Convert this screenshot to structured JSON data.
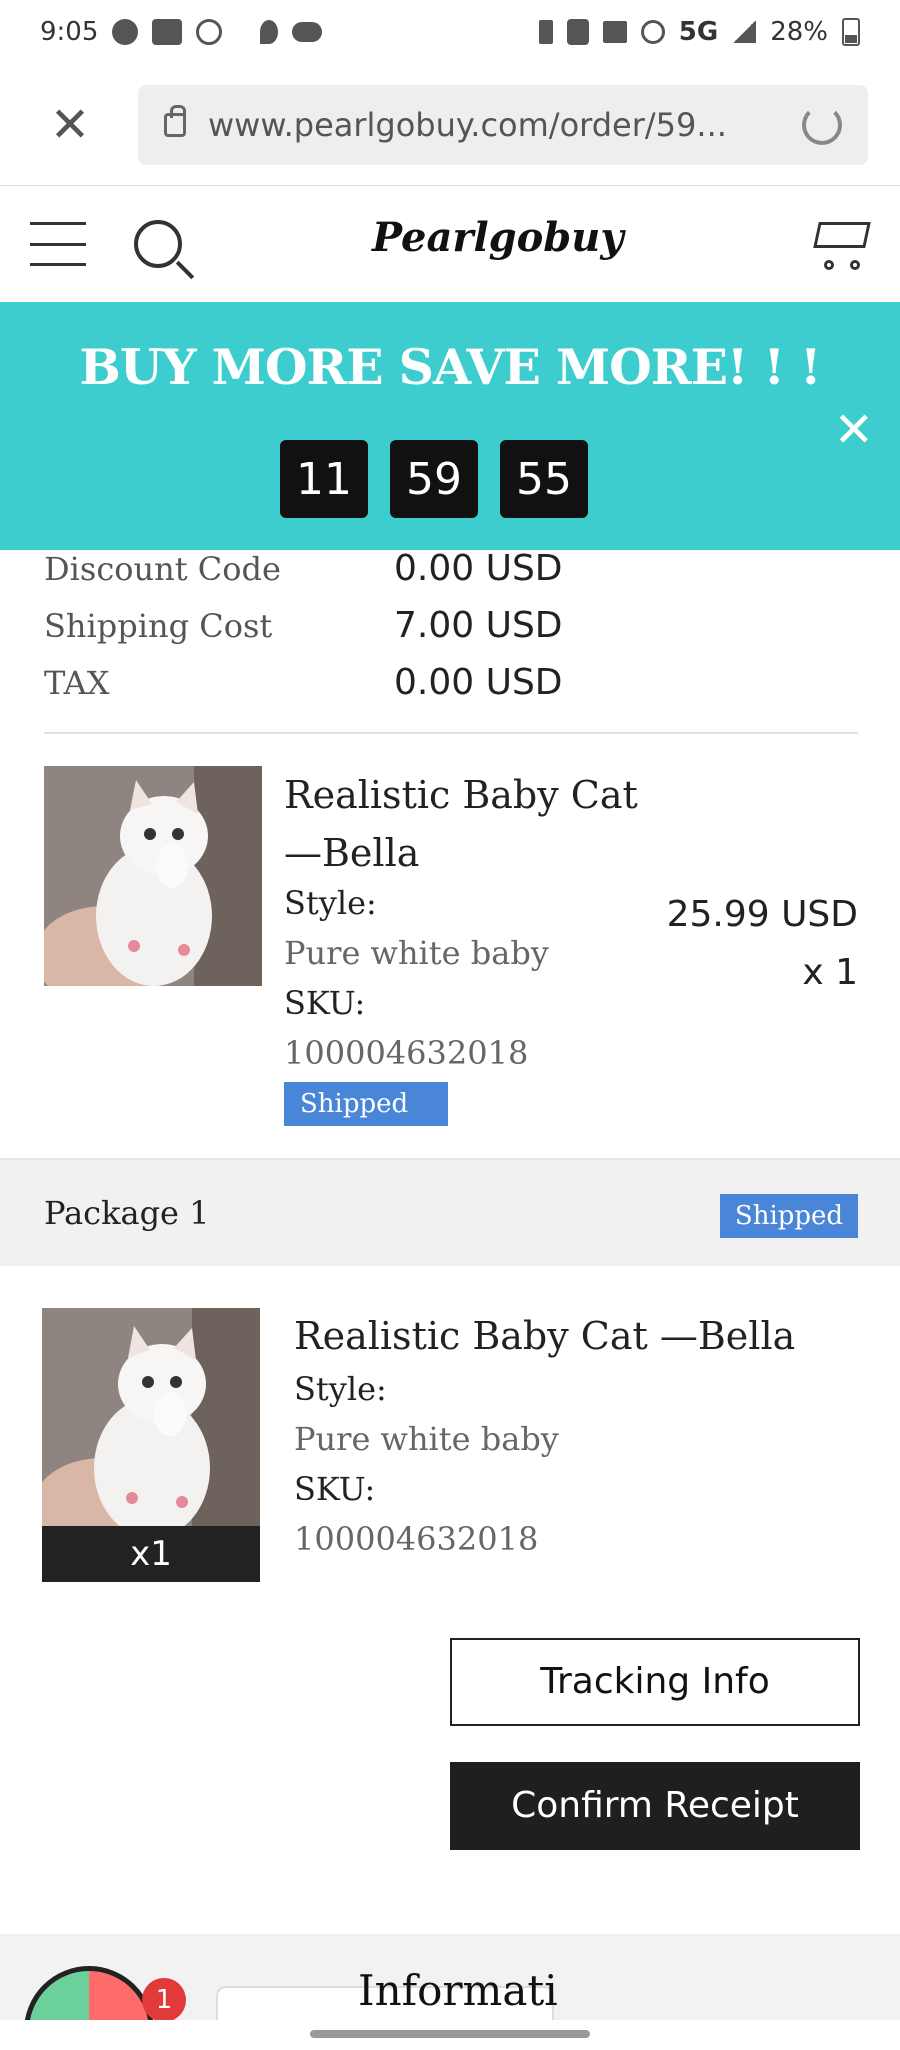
{
  "status_bar": {
    "time": "9:05",
    "network": "5G",
    "battery": "28%"
  },
  "browser": {
    "url": "www.pearlgobuy.com/order/59..."
  },
  "header": {
    "logo": "Pearlgobuy"
  },
  "promo": {
    "title": "BUY MORE SAVE MORE! ! !",
    "timer": [
      "11",
      "59",
      "55"
    ]
  },
  "summary": [
    {
      "label": "Discount Code",
      "value": "0.00 USD"
    },
    {
      "label": "Shipping Cost",
      "value": "7.00 USD"
    },
    {
      "label": "TAX",
      "value": "0.00 USD"
    }
  ],
  "order_item": {
    "name": "Realistic Baby Cat —Bella",
    "style_label": "Style:",
    "style": "Pure white baby",
    "sku_label": "SKU:",
    "sku": "100004632018",
    "status": "Shipped",
    "price": "25.99 USD",
    "qty": "x 1"
  },
  "package": {
    "title": "Package 1",
    "status": "Shipped",
    "item": {
      "qty": "x1",
      "name": "Realistic Baby Cat —Bella",
      "style_label": "Style:",
      "style": "Pure white baby",
      "sku_label": "SKU:",
      "sku": "100004632018"
    }
  },
  "actions": {
    "tracking": "Tracking Info",
    "confirm": "Confirm Receipt"
  },
  "footer": {
    "badge": "1",
    "text": "Informati"
  }
}
